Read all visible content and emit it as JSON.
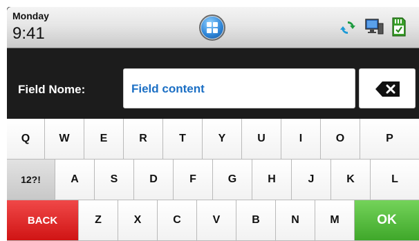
{
  "status_bar": {
    "day": "Monday",
    "time": "9:41",
    "icons": [
      "home-icon",
      "sync-icon",
      "monitor-icon",
      "sd-card-icon"
    ]
  },
  "field": {
    "label": "Field Nome:",
    "value": "Field content"
  },
  "keyboard": {
    "row1": [
      "Q",
      "W",
      "E",
      "R",
      "T",
      "Y",
      "U",
      "I",
      "O",
      "P"
    ],
    "row2": [
      "12?!",
      "A",
      "S",
      "D",
      "F",
      "G",
      "H",
      "J",
      "K",
      "L"
    ],
    "row3": [
      "BACK",
      "Z",
      "X",
      "C",
      "V",
      "B",
      "N",
      "M",
      "OK"
    ]
  },
  "colors": {
    "accent_text": "#1b6fc4",
    "back_key": "#d01414",
    "ok_key": "#3fa72a"
  }
}
